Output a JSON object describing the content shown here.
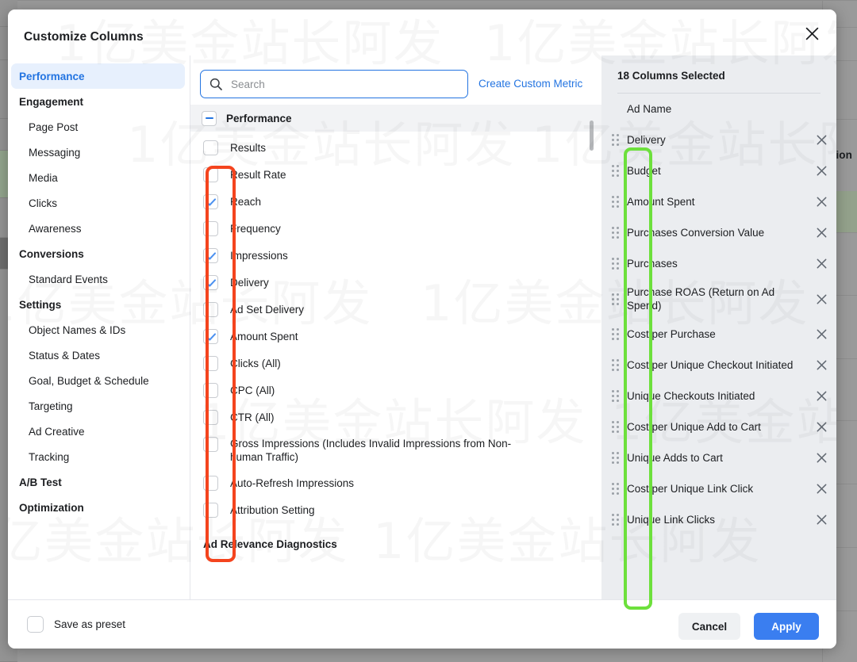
{
  "background": {
    "visible_header_fragment": "ion"
  },
  "dialog": {
    "title": "Customize Columns",
    "close_icon": "close-icon"
  },
  "sidebar": {
    "items": [
      {
        "label": "Performance",
        "level": "group",
        "active": true
      },
      {
        "label": "Engagement",
        "level": "group",
        "active": false
      },
      {
        "label": "Page Post",
        "level": "child",
        "active": false
      },
      {
        "label": "Messaging",
        "level": "child",
        "active": false
      },
      {
        "label": "Media",
        "level": "child",
        "active": false
      },
      {
        "label": "Clicks",
        "level": "child",
        "active": false
      },
      {
        "label": "Awareness",
        "level": "child",
        "active": false
      },
      {
        "label": "Conversions",
        "level": "group",
        "active": false
      },
      {
        "label": "Standard Events",
        "level": "child",
        "active": false
      },
      {
        "label": "Settings",
        "level": "group",
        "active": false
      },
      {
        "label": "Object Names & IDs",
        "level": "child",
        "active": false
      },
      {
        "label": "Status & Dates",
        "level": "child",
        "active": false
      },
      {
        "label": "Goal, Budget & Schedule",
        "level": "child",
        "active": false
      },
      {
        "label": "Targeting",
        "level": "child",
        "active": false
      },
      {
        "label": "Ad Creative",
        "level": "child",
        "active": false
      },
      {
        "label": "Tracking",
        "level": "child",
        "active": false
      },
      {
        "label": "A/B Test",
        "level": "group",
        "active": false
      },
      {
        "label": "Optimization",
        "level": "group",
        "active": false
      }
    ]
  },
  "search": {
    "value": "",
    "placeholder": "Search",
    "icon": "search-icon"
  },
  "create_custom_metric": {
    "label": "Create Custom Metric"
  },
  "metrics": {
    "section_title": "Performance",
    "collapse_icon": "minus-icon",
    "items": [
      {
        "label": "Results",
        "checked": false
      },
      {
        "label": "Result Rate",
        "checked": false
      },
      {
        "label": "Reach",
        "checked": true
      },
      {
        "label": "Frequency",
        "checked": false
      },
      {
        "label": "Impressions",
        "checked": true
      },
      {
        "label": "Delivery",
        "checked": true
      },
      {
        "label": "Ad Set Delivery",
        "checked": false
      },
      {
        "label": "Amount Spent",
        "checked": true
      },
      {
        "label": "Clicks (All)",
        "checked": false
      },
      {
        "label": "CPC (All)",
        "checked": false
      },
      {
        "label": "CTR (All)",
        "checked": false
      },
      {
        "label": "Gross Impressions (Includes Invalid Impressions from Non-human Traffic)",
        "checked": false
      },
      {
        "label": "Auto-Refresh Impressions",
        "checked": false
      },
      {
        "label": "Attribution Setting",
        "checked": false
      }
    ],
    "next_section_title": "Ad Relevance Diagnostics"
  },
  "selected_panel": {
    "header": "18 Columns Selected",
    "items": [
      {
        "label": "Ad Name",
        "draggable": false,
        "removable": false
      },
      {
        "label": "Delivery",
        "draggable": true,
        "removable": true
      },
      {
        "label": "Budget",
        "draggable": true,
        "removable": true
      },
      {
        "label": "Amount Spent",
        "draggable": true,
        "removable": true
      },
      {
        "label": "Purchases Conversion Value",
        "draggable": true,
        "removable": true
      },
      {
        "label": "Purchases",
        "draggable": true,
        "removable": true
      },
      {
        "label": "Purchase ROAS (Return on Ad Spend)",
        "draggable": true,
        "removable": true
      },
      {
        "label": "Cost per Purchase",
        "draggable": true,
        "removable": true
      },
      {
        "label": "Cost per Unique Checkout Initiated",
        "draggable": true,
        "removable": true
      },
      {
        "label": "Unique Checkouts Initiated",
        "draggable": true,
        "removable": true
      },
      {
        "label": "Cost per Unique Add to Cart",
        "draggable": true,
        "removable": true
      },
      {
        "label": "Unique Adds to Cart",
        "draggable": true,
        "removable": true
      },
      {
        "label": "Cost per Unique Link Click",
        "draggable": true,
        "removable": true
      },
      {
        "label": "Unique Link Clicks",
        "draggable": true,
        "removable": true
      }
    ]
  },
  "footer": {
    "save_preset_label": "Save as preset",
    "save_preset_checked": false,
    "cancel_label": "Cancel",
    "apply_label": "Apply"
  },
  "watermark": {
    "text": "1亿美金站长阿发"
  },
  "colors": {
    "accent_blue": "#2374e1",
    "apply_blue": "#3a7ef0",
    "panel_gray": "#ebedf0",
    "annotation_red": "#f4441e",
    "annotation_green": "#6de03c"
  }
}
